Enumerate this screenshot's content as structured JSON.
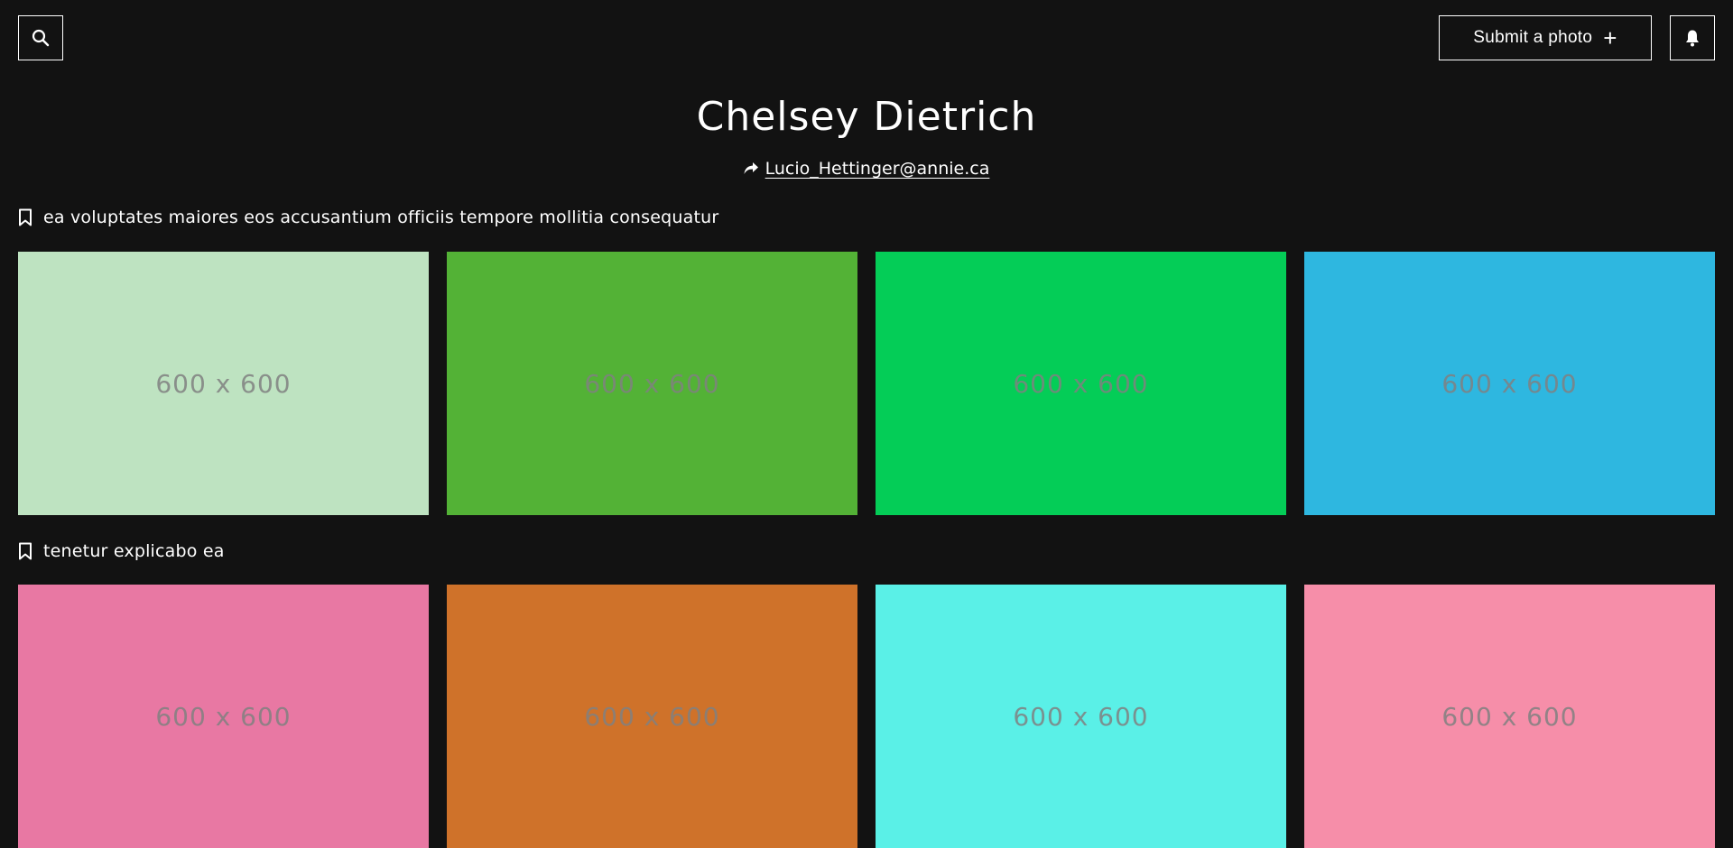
{
  "header": {
    "search_icon": "search-icon",
    "submit_label": "Submit a photo",
    "submit_icon": "+",
    "bell_icon": "bell-icon"
  },
  "profile": {
    "name": "Chelsey Dietrich",
    "contact_icon": "share-icon",
    "email": "Lucio_Hettinger@annie.ca"
  },
  "collections": [
    {
      "title": "ea voluptates maiores eos accusantium officiis tempore mollitia consequatur",
      "photos": [
        {
          "label": "600 x 600",
          "color": "#bee3c1"
        },
        {
          "label": "600 x 600",
          "color": "#53b236"
        },
        {
          "label": "600 x 600",
          "color": "#04cd57"
        },
        {
          "label": "600 x 600",
          "color": "#2eb7e0"
        }
      ]
    },
    {
      "title": "tenetur explicabo ea",
      "photos": [
        {
          "label": "600 x 600",
          "color": "#e878a3"
        },
        {
          "label": "600 x 600",
          "color": "#cf722a"
        },
        {
          "label": "600 x 600",
          "color": "#5af0e7"
        },
        {
          "label": "600 x 600",
          "color": "#f68ea9"
        }
      ]
    }
  ]
}
